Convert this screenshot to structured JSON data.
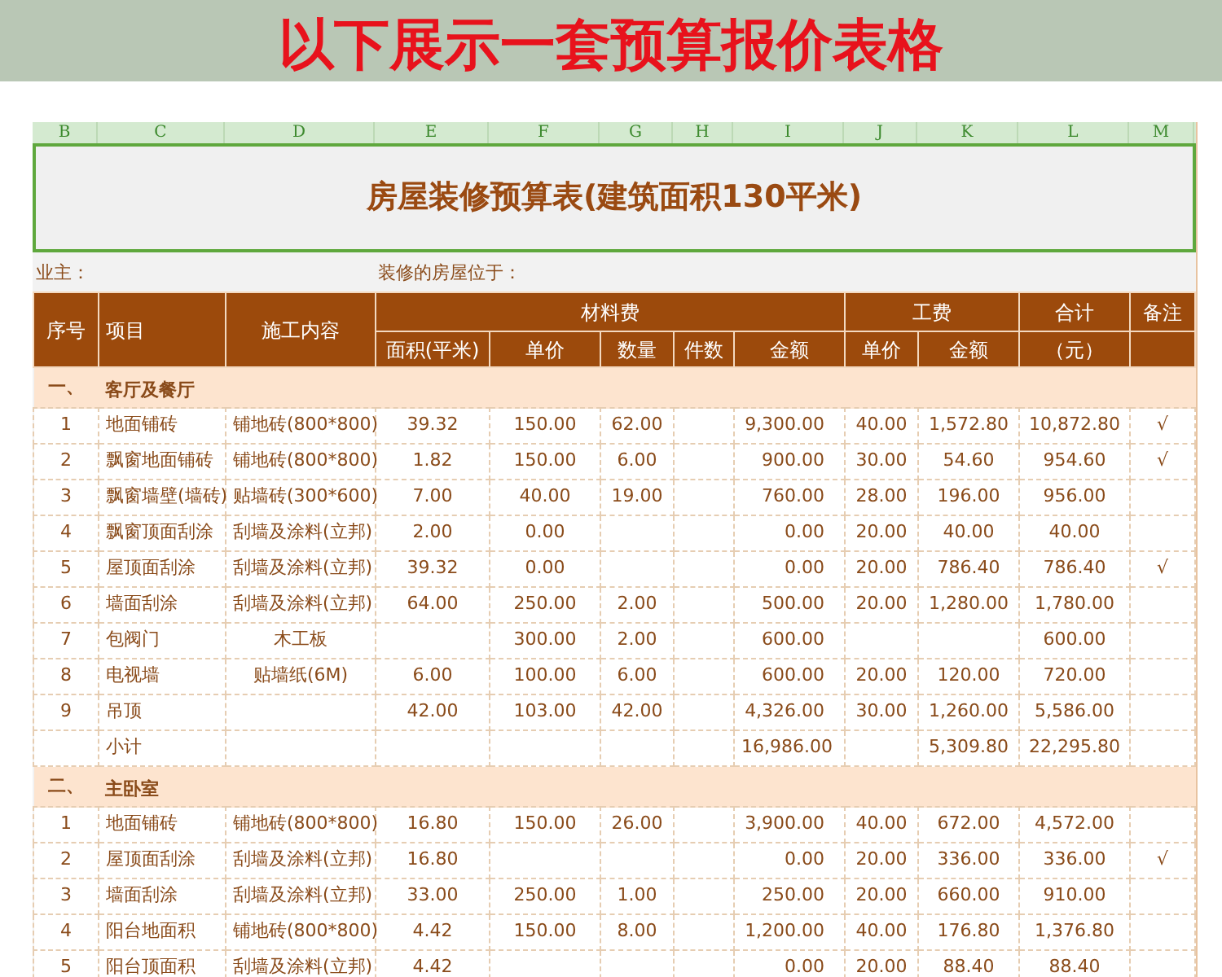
{
  "banner": {
    "title": "以下展示一套预算报价表格"
  },
  "sheet": {
    "column_letters": [
      "B",
      "C",
      "D",
      "E",
      "F",
      "G",
      "H",
      "I",
      "J",
      "K",
      "L",
      "M"
    ],
    "title": "房屋装修预算表(建筑面积130平米)",
    "owner_label": "业主：",
    "location_label": "装修的房屋位于：",
    "header": {
      "top": [
        "序号",
        "项目",
        "施工内容",
        "材料费",
        "工费",
        "合计",
        "备注"
      ],
      "sub": [
        "面积(平米)",
        "单价",
        "数量",
        "件数",
        "金额",
        "单价",
        "金额",
        "（元）"
      ]
    },
    "sections": [
      {
        "number": "一、",
        "name": "客厅及餐厅",
        "rows": [
          {
            "no": "1",
            "item": "地面铺砖",
            "work": "铺地砖(800*800)",
            "area": "39.32",
            "price": "150.00",
            "qty": "62.00",
            "amount": "9,300.00",
            "labor_price": "40.00",
            "labor_amount": "1,572.80",
            "total": "10,872.80",
            "note": "√"
          },
          {
            "no": "2",
            "item": "飘窗地面铺砖",
            "work": "铺地砖(800*800)",
            "area": "1.82",
            "price": "150.00",
            "qty": "6.00",
            "amount": "900.00",
            "labor_price": "30.00",
            "labor_amount": "54.60",
            "total": "954.60",
            "note": "√"
          },
          {
            "no": "3",
            "item": "飘窗墙壁(墙砖)",
            "work": "贴墙砖(300*600)",
            "area": "7.00",
            "price": "40.00",
            "qty": "19.00",
            "amount": "760.00",
            "labor_price": "28.00",
            "labor_amount": "196.00",
            "total": "956.00"
          },
          {
            "no": "4",
            "item": "飘窗顶面刮涂",
            "work": "刮墙及涂料(立邦)",
            "area": "2.00",
            "price": "0.00",
            "amount": "0.00",
            "labor_price": "20.00",
            "labor_amount": "40.00",
            "total": "40.00"
          },
          {
            "no": "5",
            "item": "屋顶面刮涂",
            "work": "刮墙及涂料(立邦)",
            "area": "39.32",
            "price": "0.00",
            "amount": "0.00",
            "labor_price": "20.00",
            "labor_amount": "786.40",
            "total": "786.40",
            "note": "√"
          },
          {
            "no": "6",
            "item": "墙面刮涂",
            "work": "刮墙及涂料(立邦)",
            "area": "64.00",
            "price": "250.00",
            "qty": "2.00",
            "amount": "500.00",
            "labor_price": "20.00",
            "labor_amount": "1,280.00",
            "total": "1,780.00"
          },
          {
            "no": "7",
            "item": "包阀门",
            "work": "木工板",
            "price": "300.00",
            "qty": "2.00",
            "amount": "600.00",
            "total": "600.00"
          },
          {
            "no": "8",
            "item": "电视墙",
            "work": "贴墙纸(6M)",
            "area": "6.00",
            "price": "100.00",
            "qty": "6.00",
            "amount": "600.00",
            "labor_price": "20.00",
            "labor_amount": "120.00",
            "total": "720.00"
          },
          {
            "no": "9",
            "item": "吊顶",
            "area": "42.00",
            "price": "103.00",
            "qty": "42.00",
            "amount": "4,326.00",
            "labor_price": "30.00",
            "labor_amount": "1,260.00",
            "total": "5,586.00"
          },
          {
            "item": "小计",
            "amount": "16,986.00",
            "labor_amount": "5,309.80",
            "total": "22,295.80"
          }
        ]
      },
      {
        "number": "二、",
        "name": "主卧室",
        "rows": [
          {
            "no": "1",
            "item": "地面铺砖",
            "work": "铺地砖(800*800)",
            "area": "16.80",
            "price": "150.00",
            "qty": "26.00",
            "amount": "3,900.00",
            "labor_price": "40.00",
            "labor_amount": "672.00",
            "total": "4,572.00"
          },
          {
            "no": "2",
            "item": "屋顶面刮涂",
            "work": "刮墙及涂料(立邦)",
            "area": "16.80",
            "amount": "0.00",
            "labor_price": "20.00",
            "labor_amount": "336.00",
            "total": "336.00",
            "note": "√"
          },
          {
            "no": "3",
            "item": "墙面刮涂",
            "work": "刮墙及涂料(立邦)",
            "area": "33.00",
            "price": "250.00",
            "qty": "1.00",
            "amount": "250.00",
            "labor_price": "20.00",
            "labor_amount": "660.00",
            "total": "910.00"
          },
          {
            "no": "4",
            "item": "阳台地面积",
            "work": "铺地砖(800*800)",
            "area": "4.42",
            "price": "150.00",
            "qty": "8.00",
            "amount": "1,200.00",
            "labor_price": "40.00",
            "labor_amount": "176.80",
            "total": "1,376.80"
          },
          {
            "no": "5",
            "item": "阳台顶面积",
            "work": "刮墙及涂料(立邦)",
            "area": "4.42",
            "amount": "0.00",
            "labor_price": "20.00",
            "labor_amount": "88.40",
            "total": "88.40"
          }
        ]
      }
    ]
  }
}
